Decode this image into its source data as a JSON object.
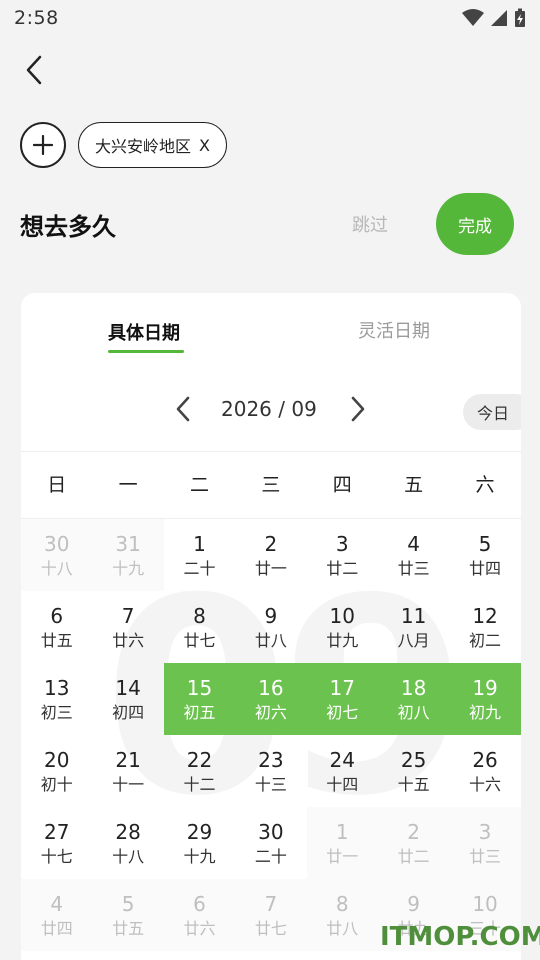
{
  "status_bar": {
    "time": "2:58"
  },
  "tags": [
    {
      "label": "大兴安岭地区",
      "close": "X"
    }
  ],
  "question": {
    "title": "想去多久",
    "skip": "跳过",
    "done": "完成"
  },
  "tabs": {
    "active": "具体日期",
    "inactive": "灵活日期"
  },
  "month_nav": {
    "label": "2026 / 09",
    "today": "今日",
    "watermark": "09"
  },
  "weekdays": [
    "日",
    "一",
    "二",
    "三",
    "四",
    "五",
    "六"
  ],
  "calendar": [
    [
      {
        "d": "30",
        "l": "十八",
        "other": true
      },
      {
        "d": "31",
        "l": "十九",
        "other": true
      },
      {
        "d": "1",
        "l": "二十"
      },
      {
        "d": "2",
        "l": "廿一"
      },
      {
        "d": "3",
        "l": "廿二"
      },
      {
        "d": "4",
        "l": "廿三"
      },
      {
        "d": "5",
        "l": "廿四"
      }
    ],
    [
      {
        "d": "6",
        "l": "廿五"
      },
      {
        "d": "7",
        "l": "廿六"
      },
      {
        "d": "8",
        "l": "廿七"
      },
      {
        "d": "9",
        "l": "廿八"
      },
      {
        "d": "10",
        "l": "廿九"
      },
      {
        "d": "11",
        "l": "八月"
      },
      {
        "d": "12",
        "l": "初二"
      }
    ],
    [
      {
        "d": "13",
        "l": "初三"
      },
      {
        "d": "14",
        "l": "初四"
      },
      {
        "d": "15",
        "l": "初五",
        "selected": true
      },
      {
        "d": "16",
        "l": "初六",
        "selected": true
      },
      {
        "d": "17",
        "l": "初七",
        "selected": true
      },
      {
        "d": "18",
        "l": "初八",
        "selected": true
      },
      {
        "d": "19",
        "l": "初九",
        "selected": true
      }
    ],
    [
      {
        "d": "20",
        "l": "初十"
      },
      {
        "d": "21",
        "l": "十一"
      },
      {
        "d": "22",
        "l": "十二"
      },
      {
        "d": "23",
        "l": "十三"
      },
      {
        "d": "24",
        "l": "十四"
      },
      {
        "d": "25",
        "l": "十五"
      },
      {
        "d": "26",
        "l": "十六"
      }
    ],
    [
      {
        "d": "27",
        "l": "十七"
      },
      {
        "d": "28",
        "l": "十八"
      },
      {
        "d": "29",
        "l": "十九"
      },
      {
        "d": "30",
        "l": "二十"
      },
      {
        "d": "1",
        "l": "廿一",
        "other": true
      },
      {
        "d": "2",
        "l": "廿二",
        "other": true
      },
      {
        "d": "3",
        "l": "廿三",
        "other": true
      }
    ],
    [
      {
        "d": "4",
        "l": "廿四",
        "other": true
      },
      {
        "d": "5",
        "l": "廿五",
        "other": true
      },
      {
        "d": "6",
        "l": "廿六",
        "other": true
      },
      {
        "d": "7",
        "l": "廿七",
        "other": true
      },
      {
        "d": "8",
        "l": "廿八",
        "other": true
      },
      {
        "d": "9",
        "l": "廿九",
        "other": true
      },
      {
        "d": "10",
        "l": "三十",
        "other": true
      }
    ]
  ],
  "colors": {
    "accent": "#55b73a",
    "selected": "#6cc24f"
  },
  "watermark_text": "ITMOP.COM"
}
